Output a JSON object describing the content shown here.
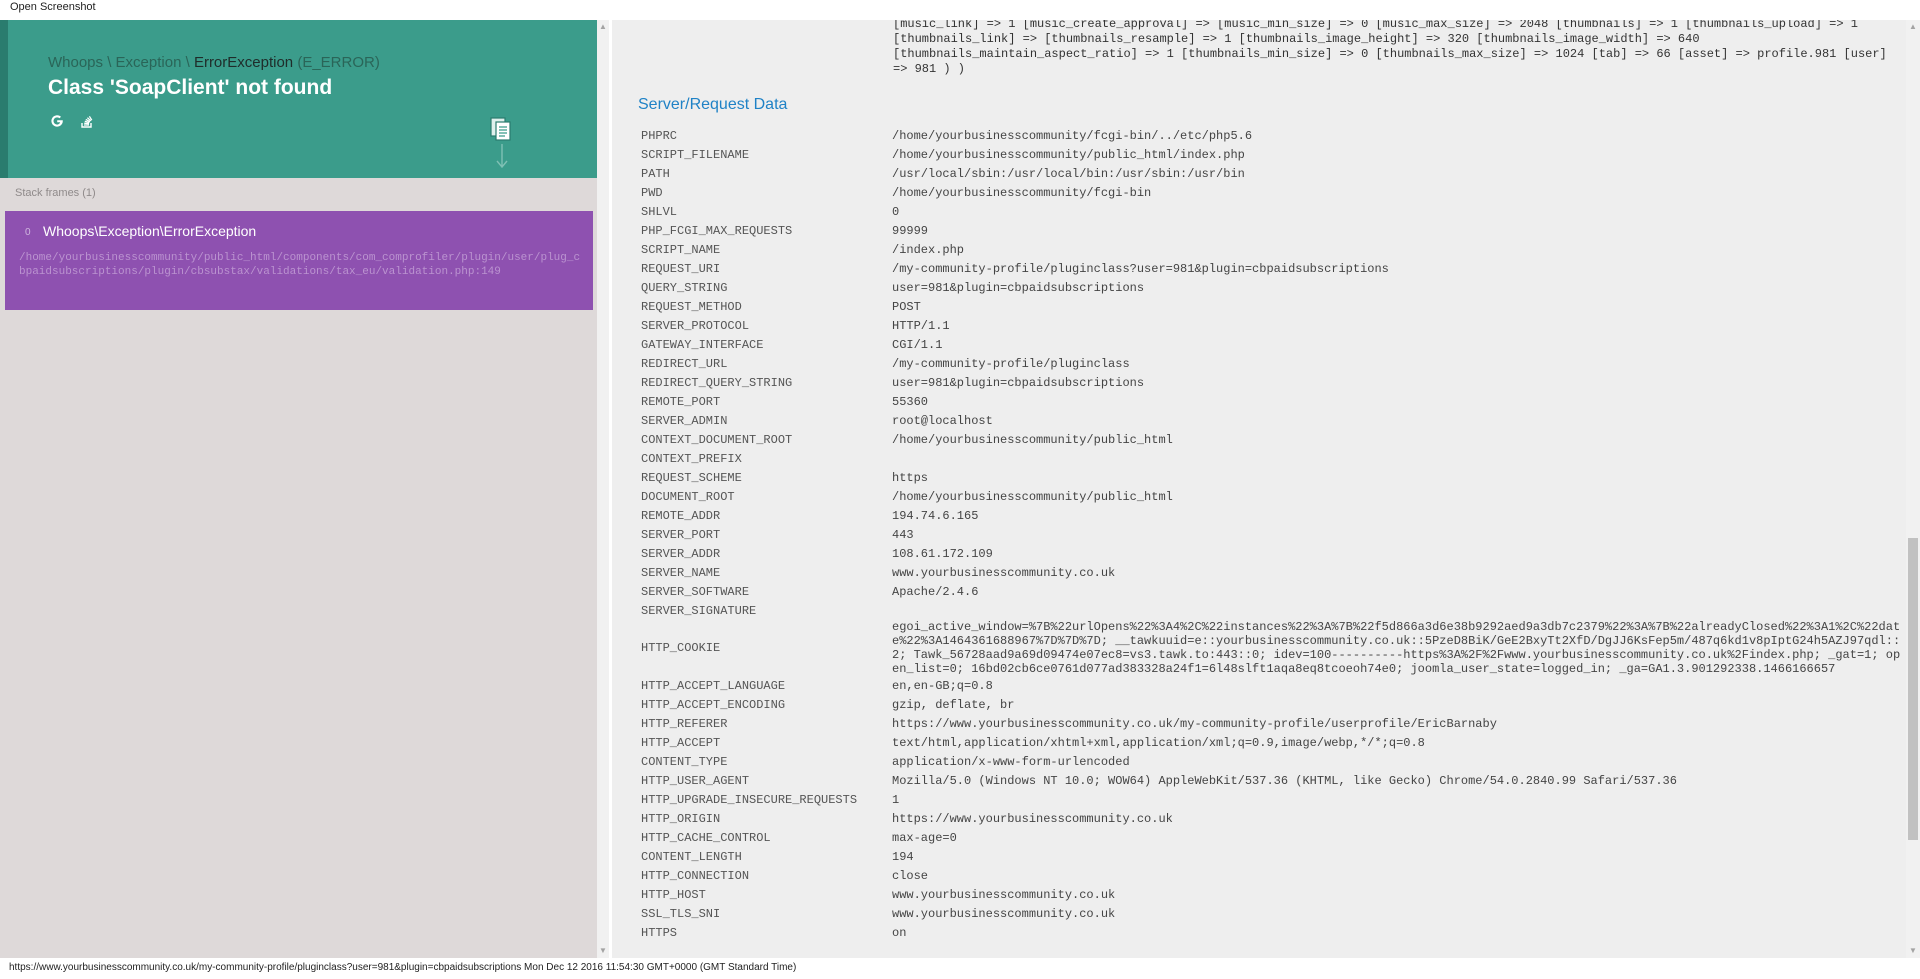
{
  "window": {
    "title": "Open Screenshot"
  },
  "exception": {
    "ns1": "Whoops",
    "ns2": "Exception",
    "cls": "ErrorException",
    "type": "(E_ERROR)",
    "message": "Class 'SoapClient' not found"
  },
  "stack": {
    "label": "Stack frames (1)",
    "frames": [
      {
        "index": "0",
        "cls": "Whoops\\Exception\\ErrorException",
        "file": "/home/yourbusinesscommunity/public_html/components/com_comprofiler/plugin/user/plug_cbpaidsubscriptions/plugin/cbsubstax/validations/tax_eu/validation.php:149"
      }
    ]
  },
  "right": {
    "dump": [
      "[music_link] => 1 [music_create_approval] => [music_min_size] => 0 [music_max_size] => 2048 [thumbnails] => 1 [thumbnails_upload] => 1",
      "[thumbnails_link] => [thumbnails_resample] => 1 [thumbnails_image_height] => 320 [thumbnails_image_width] => 640",
      "[thumbnails_maintain_aspect_ratio] => 1 [thumbnails_min_size] => 0 [thumbnails_max_size] => 1024 [tab] => 66 [asset] => profile.981 [user]",
      "=> 981 ) )"
    ],
    "section_title": "Server/Request Data",
    "rows": [
      {
        "k": "PHPRC",
        "v": "/home/yourbusinesscommunity/fcgi-bin/../etc/php5.6"
      },
      {
        "k": "SCRIPT_FILENAME",
        "v": "/home/yourbusinesscommunity/public_html/index.php"
      },
      {
        "k": "PATH",
        "v": "/usr/local/sbin:/usr/local/bin:/usr/sbin:/usr/bin"
      },
      {
        "k": "PWD",
        "v": "/home/yourbusinesscommunity/fcgi-bin"
      },
      {
        "k": "SHLVL",
        "v": "0"
      },
      {
        "k": "PHP_FCGI_MAX_REQUESTS",
        "v": "99999"
      },
      {
        "k": "SCRIPT_NAME",
        "v": "/index.php"
      },
      {
        "k": "REQUEST_URI",
        "v": "/my-community-profile/pluginclass?user=981&plugin=cbpaidsubscriptions"
      },
      {
        "k": "QUERY_STRING",
        "v": "user=981&plugin=cbpaidsubscriptions"
      },
      {
        "k": "REQUEST_METHOD",
        "v": "POST"
      },
      {
        "k": "SERVER_PROTOCOL",
        "v": "HTTP/1.1"
      },
      {
        "k": "GATEWAY_INTERFACE",
        "v": "CGI/1.1"
      },
      {
        "k": "REDIRECT_URL",
        "v": "/my-community-profile/pluginclass"
      },
      {
        "k": "REDIRECT_QUERY_STRING",
        "v": "user=981&plugin=cbpaidsubscriptions"
      },
      {
        "k": "REMOTE_PORT",
        "v": "55360"
      },
      {
        "k": "SERVER_ADMIN",
        "v": "root@localhost"
      },
      {
        "k": "CONTEXT_DOCUMENT_ROOT",
        "v": "/home/yourbusinesscommunity/public_html"
      },
      {
        "k": "CONTEXT_PREFIX",
        "v": ""
      },
      {
        "k": "REQUEST_SCHEME",
        "v": "https"
      },
      {
        "k": "DOCUMENT_ROOT",
        "v": "/home/yourbusinesscommunity/public_html"
      },
      {
        "k": "REMOTE_ADDR",
        "v": "194.74.6.165"
      },
      {
        "k": "SERVER_PORT",
        "v": "443"
      },
      {
        "k": "SERVER_ADDR",
        "v": "108.61.172.109"
      },
      {
        "k": "SERVER_NAME",
        "v": "www.yourbusinesscommunity.co.uk"
      },
      {
        "k": "SERVER_SOFTWARE",
        "v": "Apache/2.4.6"
      },
      {
        "k": "SERVER_SIGNATURE",
        "v": ""
      },
      {
        "k": "HTTP_COOKIE",
        "v": "egoi_active_window=%7B%22urlOpens%22%3A4%2C%22instances%22%3A%7B%22f5d866a3d6e38b9292aed9a3db7c2379%22%3A%7B%22alreadyClosed%22%3A1%2C%22date%22%3A1464361688967%7D%7D%7D; __tawkuuid=e::yourbusinesscommunity.co.uk::5PzeD8BiK/GeE2BxyTt2XfD/DgJJ6KsFep5m/487q6kd1v8pIptG24h5AZJ97qdl::2; Tawk_56728aad9a69d09474e07ec8=vs3.tawk.to:443::0; idev=100----------https%3A%2F%2Fwww.yourbusinesscommunity.co.uk%2Findex.php; _gat=1; open_list=0; 16bd02cb6ce0761d077ad383328a24f1=6l48slft1aqa8eq8tcoeoh74e0; joomla_user_state=logged_in; _ga=GA1.3.901292338.1466166657"
      },
      {
        "k": "HTTP_ACCEPT_LANGUAGE",
        "v": "en,en-GB;q=0.8"
      },
      {
        "k": "HTTP_ACCEPT_ENCODING",
        "v": "gzip, deflate, br"
      },
      {
        "k": "HTTP_REFERER",
        "v": "https://www.yourbusinesscommunity.co.uk/my-community-profile/userprofile/EricBarnaby"
      },
      {
        "k": "HTTP_ACCEPT",
        "v": "text/html,application/xhtml+xml,application/xml;q=0.9,image/webp,*/*;q=0.8"
      },
      {
        "k": "CONTENT_TYPE",
        "v": "application/x-www-form-urlencoded"
      },
      {
        "k": "HTTP_USER_AGENT",
        "v": "Mozilla/5.0 (Windows NT 10.0; WOW64) AppleWebKit/537.36 (KHTML, like Gecko) Chrome/54.0.2840.99 Safari/537.36"
      },
      {
        "k": "HTTP_UPGRADE_INSECURE_REQUESTS",
        "v": "1"
      },
      {
        "k": "HTTP_ORIGIN",
        "v": "https://www.yourbusinesscommunity.co.uk"
      },
      {
        "k": "HTTP_CACHE_CONTROL",
        "v": "max-age=0"
      },
      {
        "k": "CONTENT_LENGTH",
        "v": "194"
      },
      {
        "k": "HTTP_CONNECTION",
        "v": "close"
      },
      {
        "k": "HTTP_HOST",
        "v": "www.yourbusinesscommunity.co.uk"
      },
      {
        "k": "SSL_TLS_SNI",
        "v": "www.yourbusinesscommunity.co.uk"
      },
      {
        "k": "HTTPS",
        "v": "on"
      }
    ]
  },
  "status": "https://www.yourbusinesscommunity.co.uk/my-community-profile/pluginclass?user=981&plugin=cbpaidsubscriptions Mon Dec 12 2016 11:54:30 GMT+0000 (GMT Standard Time)",
  "colors": {
    "header": "#3b9c8b",
    "frame": "#8e51b0",
    "section_title": "#1f82c6"
  },
  "icons": [
    "google-search-icon",
    "stackoverflow-icon",
    "copy-icon"
  ]
}
